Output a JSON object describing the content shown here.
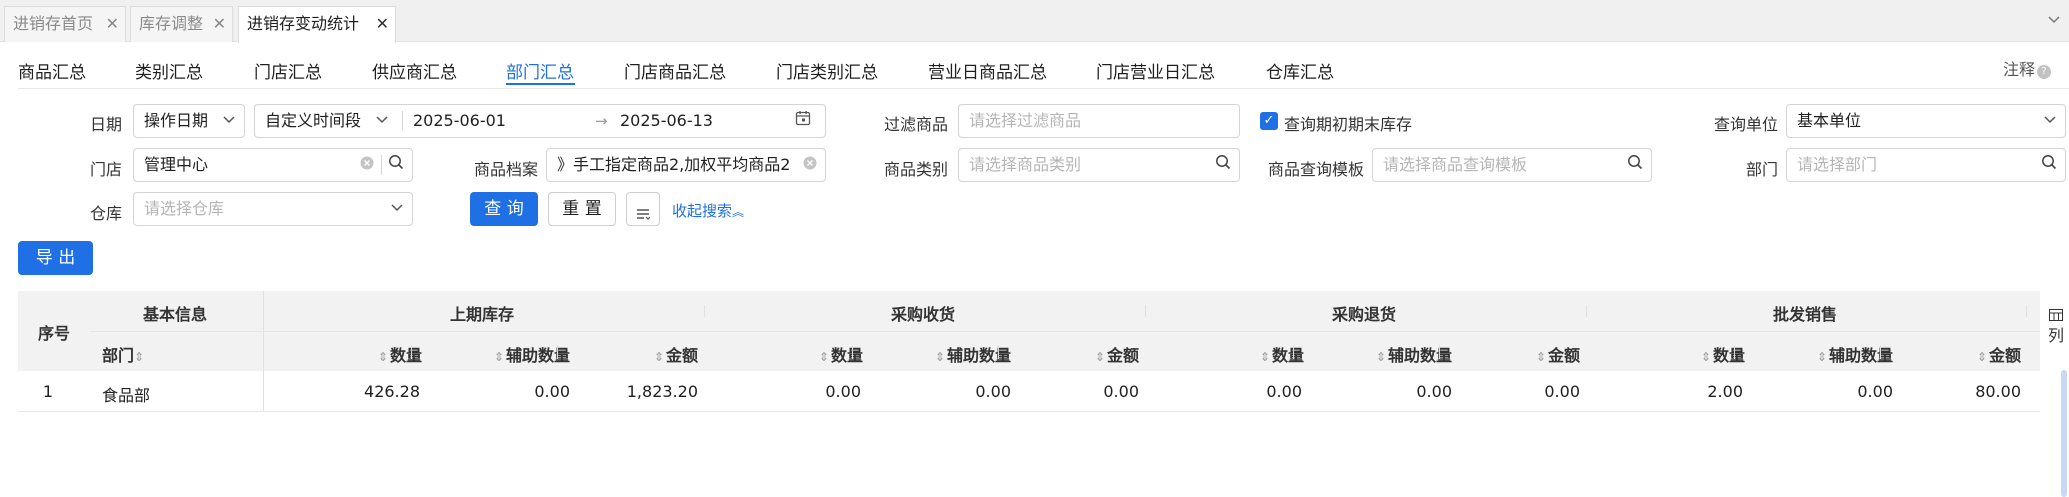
{
  "tabs": [
    {
      "label": "进销存首页",
      "active": false
    },
    {
      "label": "库存调整",
      "active": false
    },
    {
      "label": "进销存变动统计",
      "active": true
    }
  ],
  "subnav": {
    "items": [
      "商品汇总",
      "类别汇总",
      "门店汇总",
      "供应商汇总",
      "部门汇总",
      "门店商品汇总",
      "门店类别汇总",
      "营业日商品汇总",
      "门店营业日汇总",
      "仓库汇总"
    ],
    "active_index": 4,
    "note_label": "注释"
  },
  "filters": {
    "date_label": "日期",
    "date_type": "操作日期",
    "date_range_type": "自定义时间段",
    "date_start": "2025-06-01",
    "date_end": "2025-06-13",
    "filter_goods_label": "过滤商品",
    "filter_goods_placeholder": "请选择过滤商品",
    "query_stock_label": "查询期初期末库存",
    "query_stock_checked": true,
    "unit_label": "查询单位",
    "unit_value": "基本单位",
    "store_label": "门店",
    "store_value": "管理中心",
    "goods_file_label": "商品档案",
    "goods_file_value": "》手工指定商品2,加权平均商品2",
    "goods_category_label": "商品类别",
    "goods_category_placeholder": "请选择商品类别",
    "template_label": "商品查询模板",
    "template_placeholder": "请选择商品查询模板",
    "department_label": "部门",
    "department_placeholder": "请选择部门",
    "warehouse_label": "仓库",
    "warehouse_placeholder": "请选择仓库"
  },
  "buttons": {
    "query": "查 询",
    "reset": "重 置",
    "collapse": "收起搜索",
    "export": "导 出"
  },
  "table": {
    "seq_header": "序号",
    "basic_group": "基本信息",
    "dept_header": "部门",
    "groups": [
      "上期库存",
      "采购收货",
      "采购退货",
      "批发销售"
    ],
    "sub_headers": [
      "数量",
      "辅助数量",
      "金额"
    ],
    "column_settings": "列",
    "rows": [
      {
        "seq": "1",
        "dept": "食品部",
        "values": [
          "426.28",
          "0.00",
          "1,823.20",
          "0.00",
          "0.00",
          "0.00",
          "0.00",
          "0.00",
          "0.00",
          "2.00",
          "0.00",
          "80.00"
        ]
      }
    ]
  },
  "colors": {
    "accent": "#1f6fe5"
  }
}
